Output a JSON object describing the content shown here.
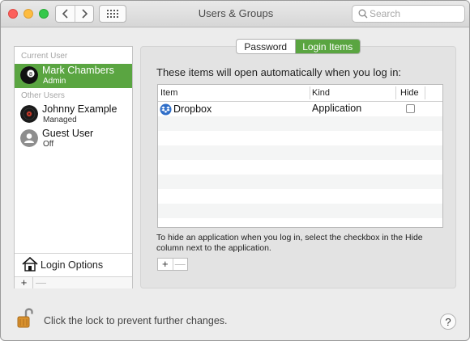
{
  "window": {
    "title": "Users & Groups"
  },
  "search": {
    "placeholder": "Search"
  },
  "sidebar": {
    "current_user_label": "Current User",
    "current_user": {
      "name": "Mark Chambers",
      "role": "Admin"
    },
    "other_users_label": "Other Users",
    "other_users": [
      {
        "name": "Johnny Example",
        "role": "Managed"
      },
      {
        "name": "Guest User",
        "role": "Off"
      }
    ],
    "login_options_label": "Login Options",
    "add_label": "+",
    "remove_label": "—"
  },
  "tabs": {
    "password": "Password",
    "login_items": "Login Items",
    "active": "login_items"
  },
  "panel": {
    "heading": "These items will open automatically when you log in:",
    "columns": {
      "item": "Item",
      "kind": "Kind",
      "hide": "Hide"
    },
    "rows": [
      {
        "item": "Dropbox",
        "kind": "Application",
        "hide": false
      }
    ],
    "note": "To hide an application when you log in, select the checkbox in the Hide column next to the application.",
    "add_label": "+",
    "remove_label": "—"
  },
  "footer": {
    "lock_text": "Click the lock to prevent further changes.",
    "help_label": "?"
  },
  "colors": {
    "accent": "#5aa541",
    "dropbox": "#2f6ec8"
  }
}
